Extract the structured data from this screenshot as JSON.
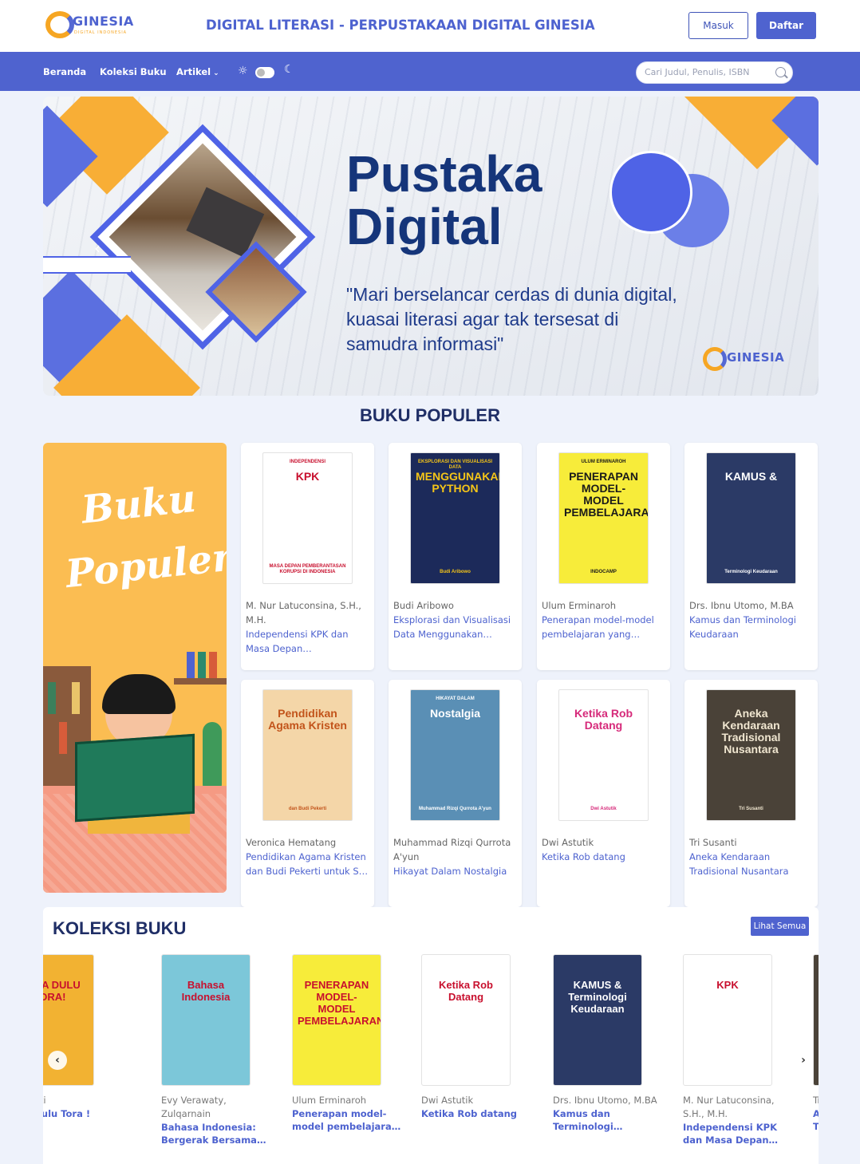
{
  "brand": {
    "logo_text": "GINESIA",
    "logo_sub": "DIGITAL INDONESIA"
  },
  "header": {
    "title": "DIGITAL LITERASI - PERPUSTAKAAN DIGITAL GINESIA",
    "login": "Masuk",
    "register": "Daftar"
  },
  "nav": {
    "items": [
      "Beranda",
      "Koleksi Buku",
      "Artikel"
    ],
    "search_placeholder": "Cari Judul, Penulis, ISBN"
  },
  "hero": {
    "title": "Pustaka\nDigital",
    "quote": "\"Mari berselancar cerdas di dunia digital, kuasai literasi agar tak tersesat di samudra informasi\"",
    "logo_text": "GINESIA"
  },
  "popular": {
    "title": "BUKU POPULER",
    "promo_text": "Buku Populer",
    "books": [
      {
        "author": "M. Nur Latuconsina, S.H., M.H.",
        "title": "Independensi KPK dan Masa Depan Pemberantasan Korupsi di Indonesia",
        "cover_title": "KPK",
        "cover_sub": "MASA DEPAN PEMBERANTASAN KORUPSI DI INDONESIA",
        "cover_top": "INDEPENDENSI",
        "color": "#c8102e",
        "bg": "#ffffff"
      },
      {
        "author": "Budi Aribowo",
        "title": "Eksplorasi dan Visualisasi Data Menggunakan Phyton",
        "cover_title": "MENGGUNAKAN PYTHON",
        "cover_sub": "Budi Aribowo",
        "cover_top": "EKSPLORASI DAN VISUALISASI DATA",
        "color": "#f5c518",
        "bg": "#1c2a5a"
      },
      {
        "author": "Ulum Erminaroh",
        "title": "Penerapan model-model pembelajaran yang menyenangkan dalam mata pelajaran matematika",
        "cover_title": "PENERAPAN MODEL-MODEL PEMBELAJARAN",
        "cover_sub": "INDOCAMP",
        "cover_top": "ULUM ERMINAROH",
        "color": "#1a1a1a",
        "bg": "#f7ec3a"
      },
      {
        "author": "Drs. Ibnu Utomo, M.BA",
        "title": "Kamus dan Terminologi Keudaraan",
        "cover_title": "KAMUS &",
        "cover_sub": "Terminologi Keudaraan",
        "cover_top": "",
        "color": "#ffffff",
        "bg": "#2b3a66"
      },
      {
        "author": "Veronica Hematang",
        "title": "Pendidikan Agama Kristen dan Budi Pekerti untuk SD Kelas II",
        "cover_title": "Pendidikan Agama Kristen",
        "cover_sub": "dan Budi Pekerti",
        "cover_top": "",
        "color": "#c2541b",
        "bg": "#f4d6a8"
      },
      {
        "author": "Muhammad Rizqi Qurrota A'yun",
        "title": "Hikayat Dalam Nostalgia",
        "cover_title": "Nostalgia",
        "cover_sub": "Muhammad Rizqi Qurrota A'yun",
        "cover_top": "HIKAYAT DALAM",
        "color": "#ffffff",
        "bg": "#5a8fb5"
      },
      {
        "author": "Dwi Astutik",
        "title": "Ketika Rob datang",
        "cover_title": "Ketika Rob Datang",
        "cover_sub": "Dwi Astutik",
        "cover_top": "",
        "color": "#d62a7a",
        "bg": "#ffffff"
      },
      {
        "author": "Tri Susanti",
        "title": "Aneka Kendaraan Tradisional Nusantara",
        "cover_title": "Aneka Kendaraan Tradisional Nusantara",
        "cover_sub": "Tri Susanti",
        "cover_top": "",
        "color": "#f0e6d0",
        "bg": "#4a4238"
      }
    ]
  },
  "collection": {
    "title": "KOLEKSI BUKU",
    "see_all": "Lihat Semua",
    "items": [
      {
        "author": "Sarastuti",
        "title": "Coba Dulu Tora !",
        "bg": "#f2b232",
        "cover_title": "COBA DULU TORA!"
      },
      {
        "author": "Evy Verawaty, Zulqarnain",
        "title": "Bahasa Indonesia: Bergerak Bersama Bahasa Indonesia",
        "bg": "#7cc7d9",
        "cover_title": "Bahasa Indonesia"
      },
      {
        "author": "Ulum Erminaroh",
        "title": "Penerapan model-model pembelajaran yang menyenangkan",
        "bg": "#f7ec3a",
        "cover_title": "PENERAPAN MODEL-MODEL PEMBELAJARAN"
      },
      {
        "author": "Dwi Astutik",
        "title": "Ketika Rob datang",
        "bg": "#ffffff",
        "cover_title": "Ketika Rob Datang"
      },
      {
        "author": "Drs. Ibnu Utomo, M.BA",
        "title": "Kamus dan Terminologi Keudaraan",
        "bg": "#2b3a66",
        "cover_title": "KAMUS & Terminologi Keudaraan"
      },
      {
        "author": "M. Nur Latuconsina, S.H., M.H.",
        "title": "Independensi KPK dan Masa Depan Pemberantasan Korupsi",
        "bg": "#ffffff",
        "cover_title": "KPK"
      },
      {
        "author": "Tri Susanti",
        "title": "Aneka Kendaraan Tradisional Nusantara",
        "bg": "#4a4238",
        "cover_title": ""
      }
    ]
  }
}
